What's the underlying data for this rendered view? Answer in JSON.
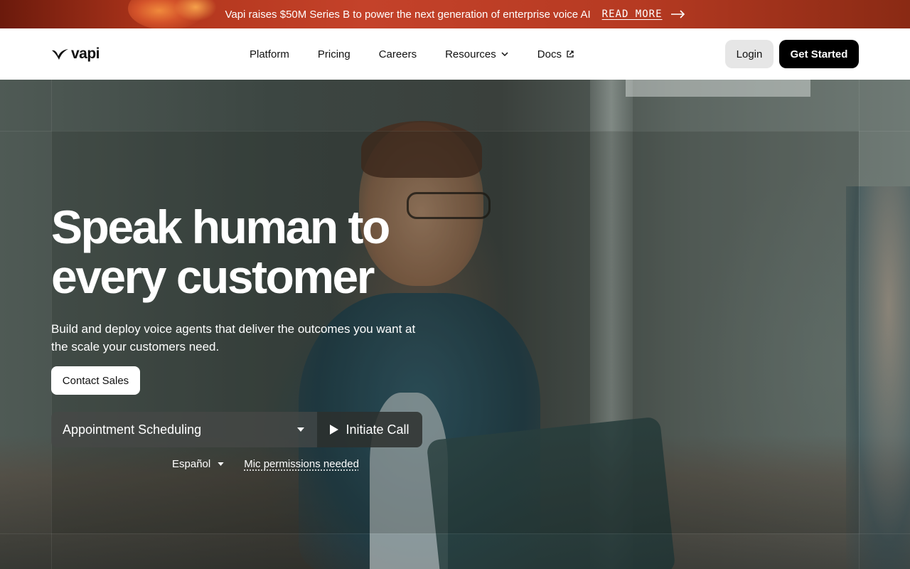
{
  "announcement": {
    "text": "Vapi raises $50M Series B to power the next generation of enterprise voice AI",
    "link_label": "READ MORE",
    "arrow_icon": "arrow-right-icon"
  },
  "header": {
    "logo_text": "vapi",
    "nav": [
      {
        "label": "Platform"
      },
      {
        "label": "Pricing"
      },
      {
        "label": "Careers"
      },
      {
        "label": "Resources",
        "icon": "chevron-down-icon"
      },
      {
        "label": "Docs",
        "icon": "external-link-icon"
      }
    ],
    "login_label": "Login",
    "cta_label": "Get Started"
  },
  "hero": {
    "headline": "Speak human to every customer",
    "subheadline": "Build and deploy voice agents that deliver the outcomes you want at the scale your customers need.",
    "contact_label": "Contact Sales",
    "scenario_value": "Appointment Scheduling",
    "call_label": "Initiate Call",
    "language_value": "Español",
    "mic_note": "Mic permissions needed"
  },
  "colors": {
    "announcement_bg": "#b2361c",
    "primary_button": "#000000",
    "secondary_button": "#e6e6e6"
  }
}
